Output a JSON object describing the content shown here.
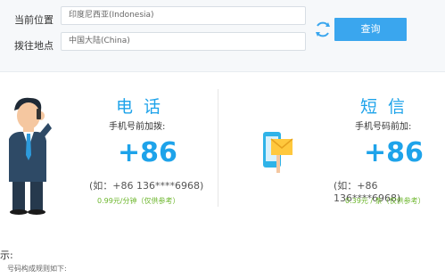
{
  "form": {
    "current_label": "当前位置",
    "current_value": "印度尼西亚(Indonesia)",
    "dial_label": "拨往地点",
    "dial_value": "中国大陆(China)",
    "query_label": "查询",
    "swap_icon": "refresh-swap-icon"
  },
  "phone": {
    "title": "电话",
    "subtitle": "手机号前加拨:",
    "code": "+86",
    "example": "(如：+86 136****6968)",
    "price": "0.99元/分钟（仅供参考）"
  },
  "sms": {
    "title": "短信",
    "subtitle": "手机号码前加:",
    "code": "+86",
    "example": "(如：+86 136****6968)",
    "price": "0.39元 / 条（仅供参考）"
  },
  "notes": {
    "title": "示:",
    "subtitle": "号码构成规则如下:"
  },
  "colors": {
    "accent": "#1ea3ea",
    "button": "#3aa6ee",
    "price": "#6cb62c"
  }
}
